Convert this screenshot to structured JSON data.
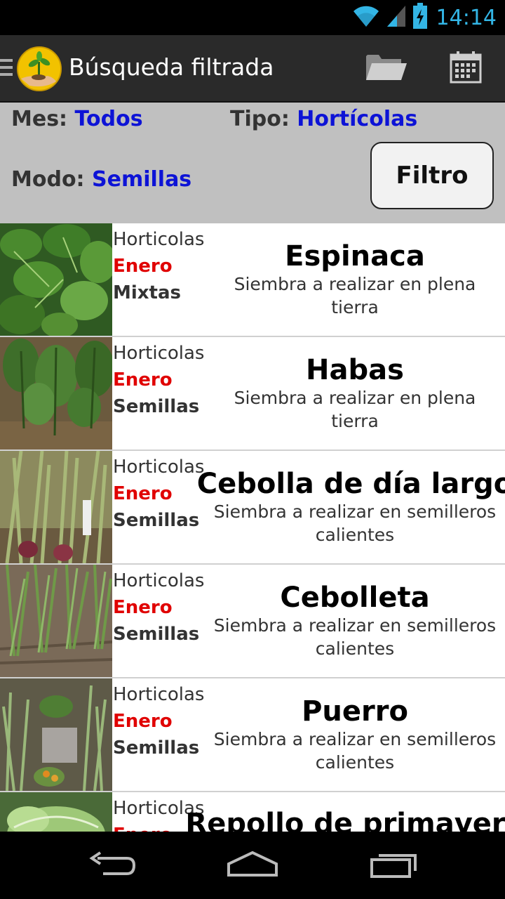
{
  "status_bar": {
    "time": "14:14"
  },
  "action_bar": {
    "title": "Búsqueda filtrada"
  },
  "filters": {
    "mes_label": "Mes:",
    "mes_value": "Todos",
    "tipo_label": "Tipo:",
    "tipo_value": "Hortícolas",
    "modo_label": "Modo:",
    "modo_value": "Semillas",
    "filter_button": "Filtro"
  },
  "items": [
    {
      "category": "Horticolas",
      "month": "Enero",
      "mode": "Mixtas",
      "name": "Espinaca",
      "description": "Siembra a realizar en plena tierra"
    },
    {
      "category": "Horticolas",
      "month": "Enero",
      "mode": "Semillas",
      "name": "Habas",
      "description": "Siembra a realizar en plena tierra"
    },
    {
      "category": "Horticolas",
      "month": "Enero",
      "mode": "Semillas",
      "name": "Cebolla de día largo",
      "description": "Siembra a realizar en semilleros calientes"
    },
    {
      "category": "Horticolas",
      "month": "Enero",
      "mode": "Semillas",
      "name": "Cebolleta",
      "description": "Siembra a realizar en semilleros calientes"
    },
    {
      "category": "Horticolas",
      "month": "Enero",
      "mode": "Semillas",
      "name": "Puerro",
      "description": "Siembra a realizar en semilleros calientes"
    },
    {
      "category": "Horticolas",
      "month": "Enero",
      "name": "Repollo de primavera"
    }
  ],
  "icons": {
    "wifi": "wifi-icon",
    "signal": "signal-icon",
    "battery": "battery-charging-icon",
    "folder": "folder-icon",
    "calendar": "calendar-icon",
    "back": "back-icon",
    "home": "home-icon",
    "recent": "recent-apps-icon"
  },
  "colors": {
    "accent_blue": "#0d13d6",
    "month_red": "#e00000",
    "clock_blue": "#33b5e5"
  }
}
